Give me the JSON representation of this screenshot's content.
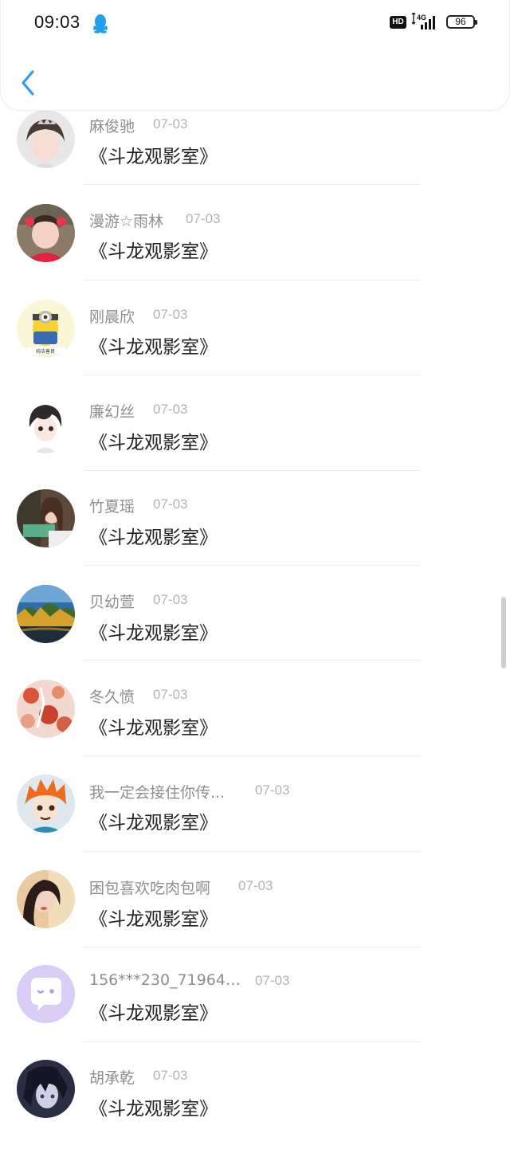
{
  "status_bar": {
    "time": "09:03",
    "hd_label": "HD",
    "network": "4G",
    "battery": "96"
  },
  "colors": {
    "accent": "#2d9bf0",
    "name_gray": "#8e8e8e",
    "date_gray": "#b3b3b3"
  },
  "items": [
    {
      "name": "麻俊驰",
      "date": "07-03",
      "message": "《斗龙观影室》",
      "avatar": "girl-crown-photo"
    },
    {
      "name": "漫游☆雨林",
      "date": "07-03",
      "message": "《斗龙观影室》",
      "avatar": "baby-photo"
    },
    {
      "name": "刚晨欣",
      "date": "07-03",
      "message": "《斗龙观影室》",
      "avatar": "minion-cartoon"
    },
    {
      "name": "廉幻丝",
      "date": "07-03",
      "message": "《斗龙观影室》",
      "avatar": "anime-boy-drawing"
    },
    {
      "name": "竹夏瑶",
      "date": "07-03",
      "message": "《斗龙观影室》",
      "avatar": "girl-photo"
    },
    {
      "name": "贝幼萱",
      "date": "07-03",
      "message": "《斗龙观影室》",
      "avatar": "landscape-photo"
    },
    {
      "name": "冬久愤",
      "date": "07-03",
      "message": "《斗龙观影室》",
      "avatar": "floral-art"
    },
    {
      "name": "我一定会接住你传...",
      "date": "07-03",
      "message": "《斗龙观影室》",
      "avatar": "anime-orange-hair"
    },
    {
      "name": "困包喜欢吃肉包啊",
      "date": "07-03",
      "message": "《斗龙观影室》",
      "avatar": "girl-portrait"
    },
    {
      "name": "156***230_719642...",
      "date": "07-03",
      "message": "《斗龙观影室》",
      "avatar": "default-chat-bubble"
    },
    {
      "name": "胡承乾",
      "date": "07-03",
      "message": "《斗龙观影室》",
      "avatar": "anime-dark-hair"
    }
  ]
}
